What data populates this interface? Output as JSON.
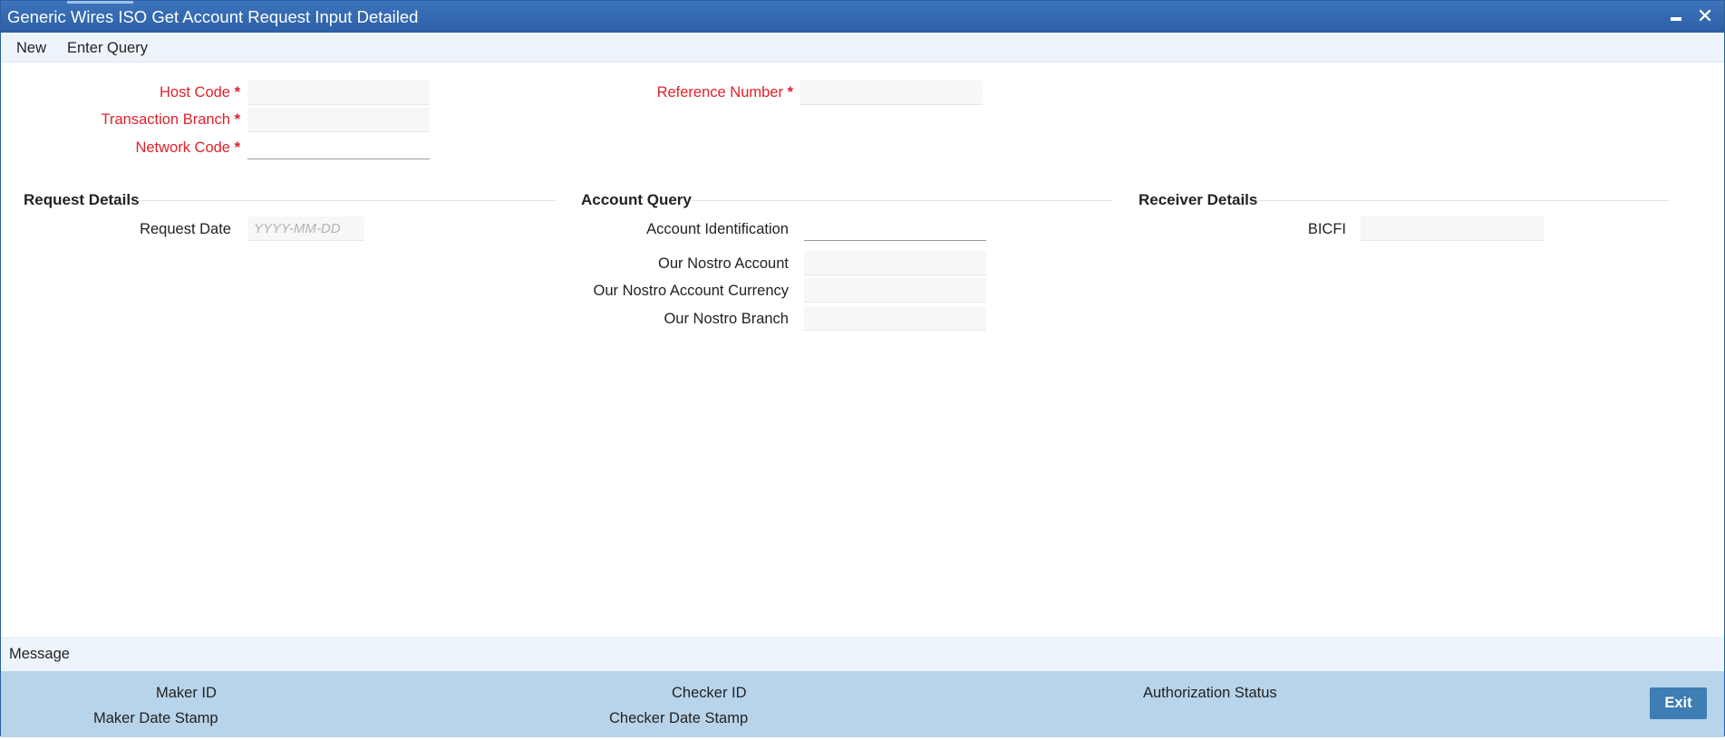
{
  "window": {
    "title": "Generic Wires ISO Get Account Request Input Detailed"
  },
  "toolbar": {
    "new_label": "New",
    "enter_query_label": "Enter Query"
  },
  "header_fields": {
    "host_code": {
      "label": "Host Code",
      "value": ""
    },
    "transaction_branch": {
      "label": "Transaction Branch",
      "value": ""
    },
    "network_code": {
      "label": "Network Code",
      "value": ""
    },
    "reference_number": {
      "label": "Reference Number",
      "value": ""
    },
    "required_marker": "*"
  },
  "request_details": {
    "heading": "Request Details",
    "request_date": {
      "label": "Request Date",
      "placeholder": "YYYY-MM-DD"
    }
  },
  "account_query": {
    "heading": "Account Query",
    "account_identification": {
      "label": "Account Identification",
      "value": ""
    },
    "our_nostro_account": {
      "label": "Our Nostro Account",
      "value": ""
    },
    "our_nostro_account_currency": {
      "label": "Our Nostro Account Currency",
      "value": ""
    },
    "our_nostro_branch": {
      "label": "Our Nostro Branch",
      "value": ""
    }
  },
  "receiver_details": {
    "heading": "Receiver Details",
    "bicfi": {
      "label": "BICFI",
      "value": ""
    }
  },
  "message_bar": {
    "label": "Message"
  },
  "footer": {
    "maker_id": "Maker ID",
    "maker_date_stamp": "Maker Date Stamp",
    "checker_id": "Checker ID",
    "checker_date_stamp": "Checker Date Stamp",
    "authorization_status": "Authorization Status",
    "exit_label": "Exit"
  },
  "colors": {
    "title_bar": "#2c5fa5",
    "required_label": "#e0212a",
    "footer_bg": "#b8d4ea",
    "exit_button": "#3f7db5"
  }
}
